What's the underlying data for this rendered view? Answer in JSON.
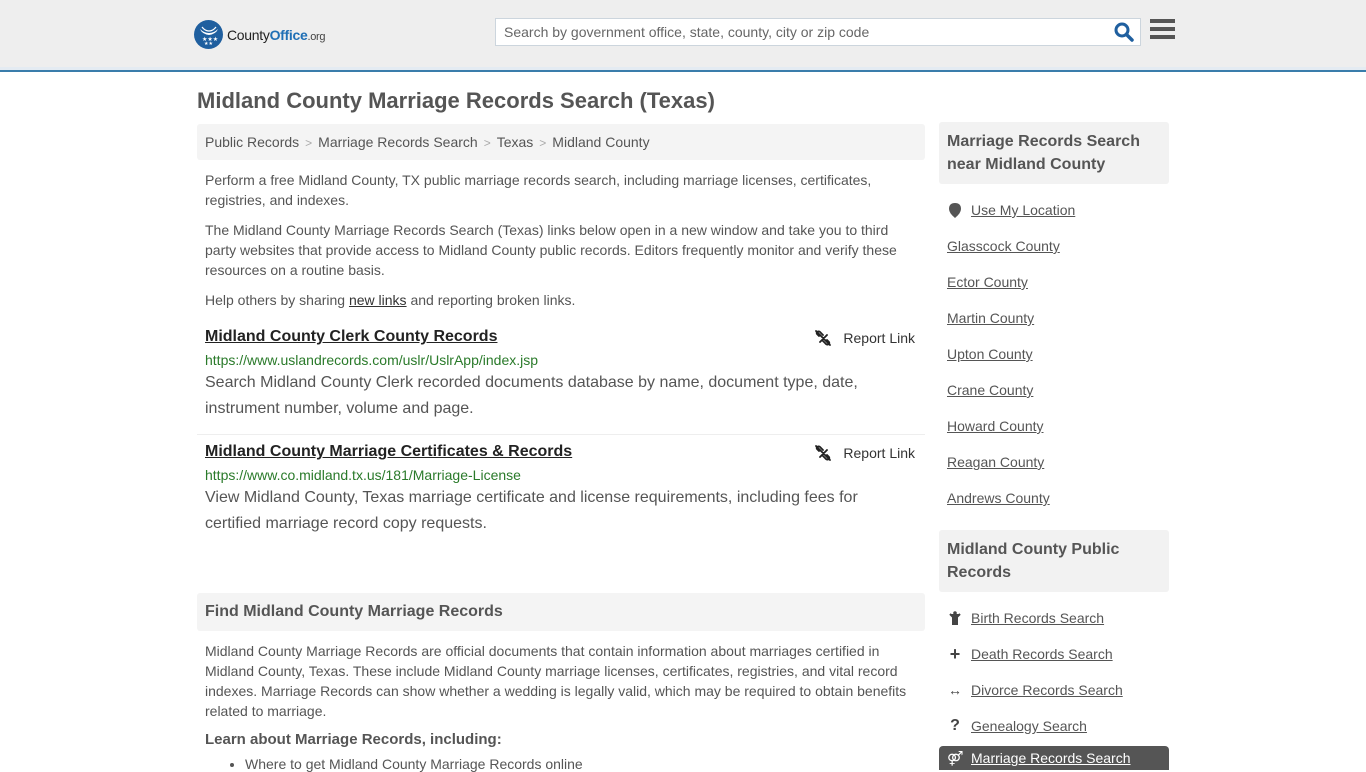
{
  "header": {
    "logo": {
      "name": "County",
      "highlight": "Office",
      "tld": ".org"
    },
    "search": {
      "placeholder": "Search by government office, state, county, city or zip code",
      "value": ""
    },
    "colors": {
      "accent": "#3a7dab",
      "logo_blue": "#1f5f9f"
    }
  },
  "page_title": "Midland County Marriage Records Search (Texas)",
  "breadcrumb": [
    "Public Records",
    "Marriage Records Search",
    "Texas",
    "Midland County"
  ],
  "intro": {
    "p1": "Perform a free Midland County, TX public marriage records search, including marriage licenses, certificates, registries, and indexes.",
    "p2": "The Midland County Marriage Records Search (Texas) links below open in a new window and take you to third party websites that provide access to Midland County public records. Editors frequently monitor and verify these resources on a routine basis.",
    "p3_before": "Help others by sharing ",
    "p3_link": "new links",
    "p3_after": " and reporting broken links."
  },
  "results": [
    {
      "title": "Midland County Clerk County Records",
      "url": "https://www.uslandrecords.com/uslr/UslrApp/index.jsp",
      "description": "Search Midland County Clerk recorded documents database by name, document type, date, instrument number, volume and page.",
      "report_label": "Report Link"
    },
    {
      "title": "Midland County Marriage Certificates & Records",
      "url": "https://www.co.midland.tx.us/181/Marriage-License",
      "description": "View Midland County, Texas marriage certificate and license requirements, including fees for certified marriage record copy requests.",
      "report_label": "Report Link"
    }
  ],
  "find_section": {
    "heading": "Find Midland County Marriage Records",
    "body": "Midland County Marriage Records are official documents that contain information about marriages certified in Midland County, Texas. These include Midland County marriage licenses, certificates, registries, and vital record indexes. Marriage Records can show whether a wedding is legally valid, which may be required to obtain benefits related to marriage.",
    "learn_heading": "Learn about Marriage Records, including:",
    "learn_items": [
      "Where to get Midland County Marriage Records online"
    ]
  },
  "sidebar": {
    "nearby": {
      "heading": "Marriage Records Search near Midland County",
      "use_location": "Use My Location",
      "counties": [
        "Glasscock County",
        "Ector County",
        "Martin County",
        "Upton County",
        "Crane County",
        "Howard County",
        "Reagan County",
        "Andrews County"
      ]
    },
    "public_records": {
      "heading": "Midland County Public Records",
      "items": [
        {
          "label": "Birth Records Search",
          "icon": "child-icon"
        },
        {
          "label": "Death Records Search",
          "icon": "plus-icon"
        },
        {
          "label": "Divorce Records Search",
          "icon": "arrows-horizontal-icon"
        },
        {
          "label": "Genealogy Search",
          "icon": "question-icon"
        }
      ],
      "active_item": {
        "label": "Marriage Records Search",
        "icon": "rings-icon"
      }
    }
  }
}
